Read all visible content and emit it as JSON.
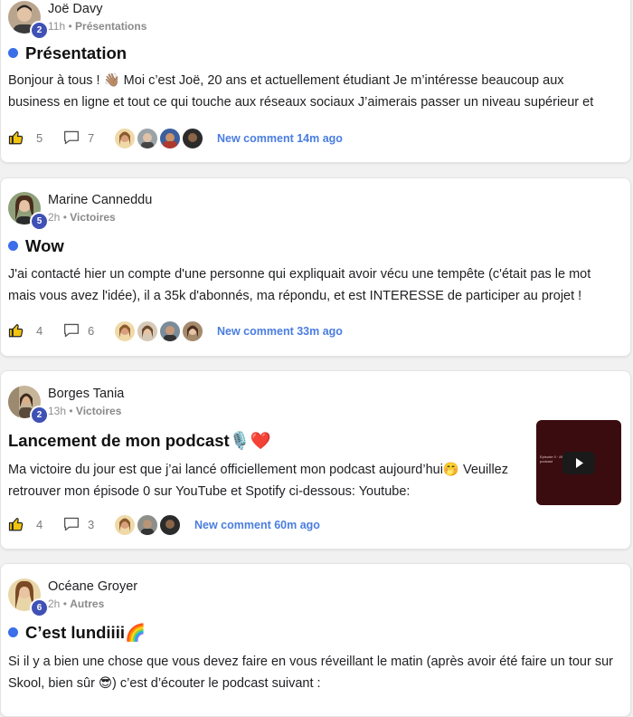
{
  "posts": [
    {
      "author": "Joë Davy",
      "level": "2",
      "time": "11h",
      "sep": "•",
      "category": "Présentations",
      "title": "Présentation",
      "title_emoji": "",
      "body_lines": [
        "Bonjour à tous ! 👋🏽 Moi c’est Joë, 20 ans et actuellement étudiant Je m’intéresse beaucoup aux",
        "business en ligne et tout ce qui touche aux réseaux sociaux J’aimerais passer un niveau supérieur et"
      ],
      "likes": "5",
      "comments": "7",
      "new_comment": "New comment 14m ago"
    },
    {
      "author": "Marine Canneddu",
      "level": "5",
      "time": "2h",
      "sep": "•",
      "category": "Victoires",
      "title": "Wow",
      "title_emoji": "",
      "body_lines": [
        "J'ai contacté hier un compte d'une personne qui expliquait avoir vécu une tempête (c'était pas le mot",
        "mais vous avez l'idée), il a 35k d'abonnés, ma répondu, et est INTERESSE de participer au projet !"
      ],
      "likes": "4",
      "comments": "6",
      "new_comment": "New comment 33m ago"
    },
    {
      "author": "Borges Tania",
      "level": "2",
      "time": "13h",
      "sep": "•",
      "category": "Victoires",
      "title": "Lancement de mon podcast",
      "title_emoji": "🎙️❤️",
      "body_lines": [
        "Ma victoire du jour est que j’ai lancé officiellement mon podcast aujourd’hui🤭 Veuillez",
        "retrouver mon épisode 0 sur YouTube et Spotify ci-dessous: Youtube:"
      ],
      "likes": "4",
      "comments": "3",
      "new_comment": "New comment 60m ago",
      "thumb_caption": "Episode 0 · ANKIDE Tasha: podcast"
    },
    {
      "author": "Océane Groyer",
      "level": "6",
      "time": "2h",
      "sep": "•",
      "category": "Autres",
      "title": "C’est lundiiii",
      "title_emoji": "🌈",
      "body_lines": [
        "Si il y a bien une chose que vous devez faire en vous réveillant le matin (après avoir été faire un tour sur",
        "Skool, bien sûr 😎) c’est d’écouter le podcast suivant :"
      ]
    }
  ],
  "colors": {
    "accent": "#3b6ee8",
    "level_badge": "#3f51b5",
    "new_comment": "#4a7de0"
  },
  "icons": [
    "thumbs-up-icon",
    "comment-icon",
    "play-icon"
  ]
}
